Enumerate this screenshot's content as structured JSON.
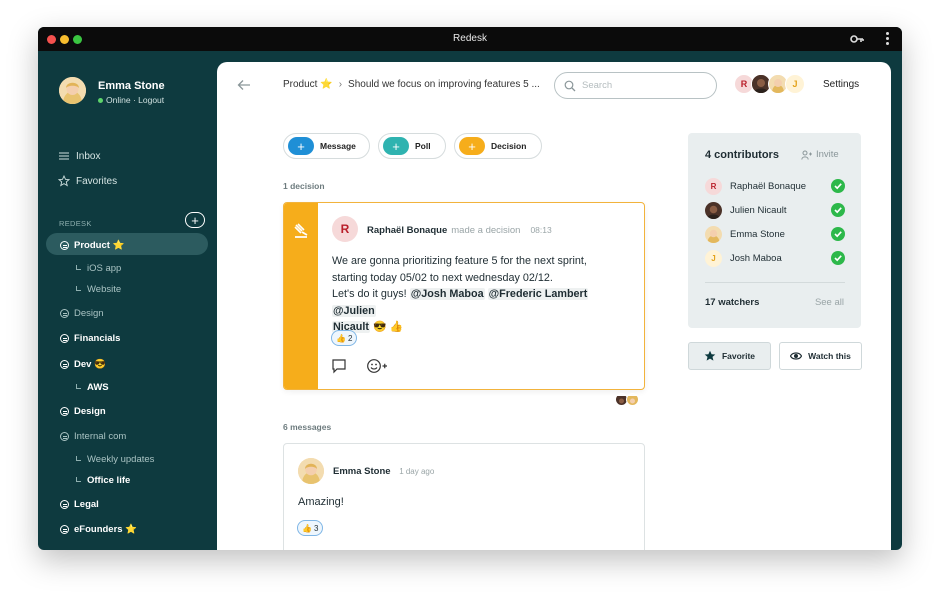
{
  "window": {
    "title": "Redesk"
  },
  "user": {
    "name": "Emma Stone",
    "status": "Online",
    "logout": "Logout"
  },
  "nav": {
    "inbox": "Inbox",
    "favorites": "Favorites"
  },
  "sidebar": {
    "section_label": "REDESK",
    "channels": [
      {
        "label": "Product ⭐"
      },
      {
        "label": "iOS app"
      },
      {
        "label": "Website"
      },
      {
        "label": "Design"
      },
      {
        "label": "Financials"
      },
      {
        "label": "Dev 😎"
      },
      {
        "label": "AWS"
      },
      {
        "label": "Design"
      },
      {
        "label": "Internal com"
      },
      {
        "label": "Weekly updates"
      },
      {
        "label": "Office life"
      },
      {
        "label": "Legal"
      },
      {
        "label": "eFounders ⭐"
      }
    ]
  },
  "header": {
    "breadcrumb_channel": "Product ⭐",
    "breadcrumb_sep": "›",
    "breadcrumb_topic": "Should we focus on improving features 5 ...",
    "search_placeholder": "Search",
    "settings": "Settings",
    "avatars": [
      "R",
      "",
      "",
      "J"
    ]
  },
  "actions": {
    "message": "Message",
    "poll": "Poll",
    "decision": "Decision"
  },
  "decision_section": {
    "count_label": "1 decision",
    "author": "Raphaël Bonaque",
    "author_initial": "R",
    "action": "made a decision",
    "time": "08:13",
    "line1": "We are gonna prioritizing feature 5 for the next sprint,",
    "line2": "starting today 05/02 to next wednesday 02/12.",
    "line3_prefix": "Let's do it guys!",
    "mention1": "@Josh Maboa",
    "mention2": "@Frederic Lambert",
    "mention3a": "@Julien",
    "mention3b": "Nicault",
    "line4_suffix": "😎 👍",
    "reaction_emoji": "👍",
    "reaction_count": "2"
  },
  "messages_section": {
    "count_label": "6 messages",
    "author": "Emma Stone",
    "time": "1 day ago",
    "body": "Amazing!",
    "reaction_emoji": "👍",
    "reaction_count": "3"
  },
  "contributors": {
    "title": "4 contributors",
    "invite": "Invite",
    "list": [
      {
        "name": "Raphaël Bonaque",
        "initial": "R"
      },
      {
        "name": "Julien Nicault",
        "initial": ""
      },
      {
        "name": "Emma Stone",
        "initial": ""
      },
      {
        "name": "Josh Maboa",
        "initial": "J"
      }
    ],
    "watchers": "17 watchers",
    "see_all": "See all"
  },
  "buttons": {
    "favorite": "Favorite",
    "watch": "Watch this"
  },
  "colors": {
    "sidebar": "#0e3a3f",
    "message_blue": "#1f8fd6",
    "poll_teal": "#2fb3b0",
    "decision_orange": "#f6ad1b",
    "check_green": "#2db84a"
  }
}
